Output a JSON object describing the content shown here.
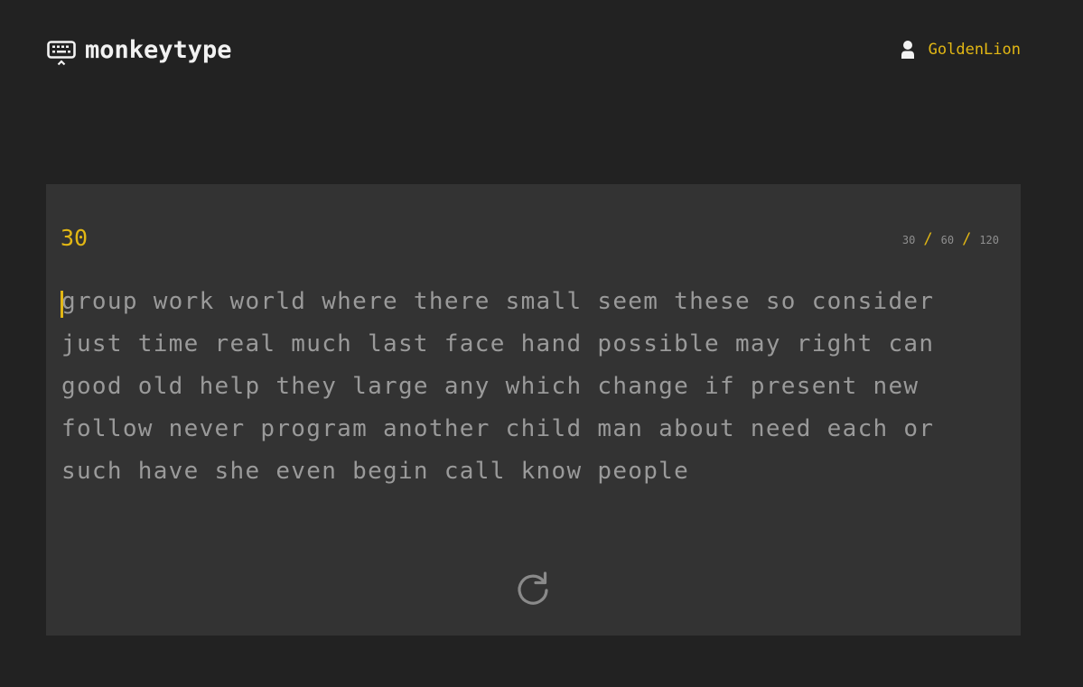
{
  "header": {
    "logo_icon": "keyboard-icon",
    "logo_text": "monkeytype",
    "user_icon": "user-icon",
    "username": "GoldenLion"
  },
  "test": {
    "timer": "30",
    "durations": [
      "30",
      "60",
      "120"
    ],
    "separator": "/",
    "lines": [
      "group work world where there small seem these so consider",
      "just time real much last face hand possible may right can",
      "good old help they large any which change if present new",
      "follow never program another child man about need each or",
      "such have she even begin call know people"
    ],
    "restart_icon": "restart-icon"
  },
  "colors": {
    "background": "#222222",
    "card": "#333333",
    "accent": "#e2b714",
    "text": "#9a9a9a",
    "logo_text": "#f2f2f2"
  }
}
